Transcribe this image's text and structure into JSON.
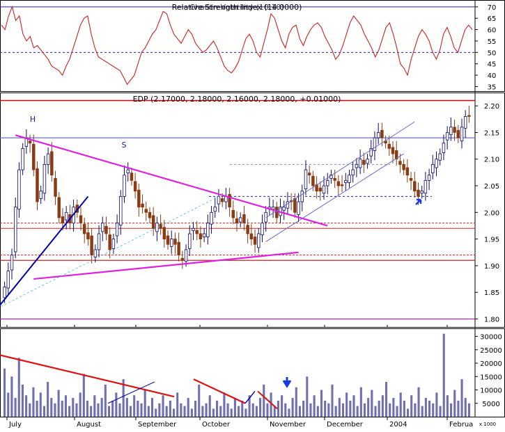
{
  "colors": {
    "frame": "#000000",
    "up_candle": "#0a0a6e",
    "down_candle": "#8b3a12",
    "indicator": "#cc2222",
    "indicator_ref_line": "#2222aa",
    "trend_magenta": "#dd22dd",
    "channel_blue": "#6666cc",
    "trend_navy": "#0000aa",
    "resistance_line": "#6666ff",
    "support_red": "#cc2222",
    "dashed_level": "#8888cc",
    "volume_bar": "#7070b0",
    "volume_trend_red": "#dd1111",
    "arrow_blue": "#1a3ae0",
    "top_red_line": "#dd0000",
    "bottom_line": "#cc00cc"
  },
  "chart_data": [
    {
      "type": "line",
      "panel": "indicator",
      "title": "Relative Strength Index (14.0000)",
      "overlaid_title": "Chaikin Volatility (10,10)",
      "y_ticks": [
        70,
        65,
        60,
        55,
        50,
        45,
        40,
        35
      ],
      "ylim": [
        33,
        73
      ],
      "reference_lines": [
        70,
        50
      ],
      "grid": false,
      "series": [
        {
          "values": [
            62,
            60,
            66,
            70,
            64,
            66,
            58,
            55,
            57,
            52,
            53,
            51,
            49,
            47,
            44,
            43,
            42,
            40,
            44,
            47,
            52,
            57,
            62,
            65,
            66,
            58,
            52,
            48,
            47,
            46,
            45,
            44,
            43,
            42,
            39,
            36,
            38,
            40,
            45,
            50,
            52,
            55,
            58,
            60,
            64,
            68,
            67,
            62,
            58,
            56,
            54,
            57,
            60,
            58,
            54,
            52,
            50,
            51,
            53,
            55,
            52,
            48,
            44,
            42,
            41,
            43,
            46,
            51,
            56,
            58,
            55,
            50,
            48,
            54,
            60,
            67,
            65,
            60,
            55,
            52,
            58,
            61,
            62,
            56,
            53,
            57,
            60,
            62,
            63,
            61,
            57,
            54,
            51,
            47,
            49,
            53,
            58,
            63,
            66,
            64,
            62,
            58,
            55,
            52,
            48,
            51,
            56,
            61,
            63,
            58,
            52,
            45,
            43,
            40,
            47,
            52,
            57,
            60,
            58,
            55,
            50,
            47,
            51,
            58,
            61,
            57,
            52,
            50,
            55,
            60,
            62,
            60
          ]
        }
      ]
    },
    {
      "type": "candlestick",
      "panel": "price",
      "title": "EDP (2.17000, 2.18000, 2.16000, 2.18000, +0.01000)",
      "y_ticks": [
        2.2,
        2.15,
        2.1,
        2.05,
        2.0,
        1.95,
        1.9,
        1.85,
        1.8
      ],
      "ylim": [
        1.785,
        2.225
      ],
      "grid": false,
      "annotations": [
        "H",
        "S"
      ],
      "horizontal_levels": [
        2.21,
        2.14,
        2.09,
        2.03,
        1.98,
        1.97,
        1.92,
        1.91,
        1.8
      ],
      "series": [
        {
          "name": "close",
          "values": [
            1.86,
            1.89,
            1.92,
            2.01,
            2.08,
            2.12,
            2.14,
            2.13,
            2.08,
            2.02,
            2.04,
            2.09,
            2.11,
            2.07,
            2.03,
            1.99,
            1.98,
            2.0,
            1.98,
            2.01,
            2.0,
            1.98,
            1.96,
            1.95,
            1.92,
            1.93,
            1.96,
            1.98,
            1.96,
            1.93,
            1.95,
            1.98,
            2.03,
            2.07,
            2.08,
            2.06,
            2.04,
            2.01,
            2.01,
            2.0,
            1.99,
            1.97,
            1.98,
            1.97,
            1.95,
            1.94,
            1.95,
            1.94,
            1.92,
            1.91,
            1.93,
            1.96,
            1.97,
            1.96,
            1.95,
            1.96,
            1.98,
            2.0,
            2.01,
            2.03,
            2.02,
            2.03,
            2.01,
            1.99,
            1.98,
            1.99,
            1.98,
            1.96,
            1.95,
            1.94,
            1.96,
            1.98,
            2.0,
            2.01,
            2.01,
            1.99,
            2.01,
            2.01,
            2.02,
            2.02,
            2.0,
            2.02,
            2.04,
            2.08,
            2.07,
            2.05,
            2.04,
            2.04,
            2.05,
            2.06,
            2.07,
            2.06,
            2.05,
            2.05,
            2.06,
            2.07,
            2.08,
            2.09,
            2.1,
            2.09,
            2.1,
            2.12,
            2.14,
            2.15,
            2.14,
            2.13,
            2.12,
            2.11,
            2.1,
            2.09,
            2.08,
            2.07,
            2.06,
            2.04,
            2.03,
            2.04,
            2.06,
            2.07,
            2.09,
            2.1,
            2.11,
            2.13,
            2.15,
            2.16,
            2.15,
            2.14,
            2.16,
            2.18,
            2.18
          ]
        }
      ]
    },
    {
      "type": "bar",
      "panel": "volume",
      "x_ticks": [
        "July",
        "August",
        "September",
        "October",
        "November",
        "December",
        "2004",
        "Februa"
      ],
      "y_ticks": [
        30000,
        25000,
        20000,
        15000,
        10000,
        5000
      ],
      "y_unit": "x 1000",
      "ylim": [
        0,
        33000
      ],
      "grid": false,
      "series": [
        {
          "values": [
            18000,
            9000,
            15000,
            7000,
            22000,
            12000,
            8000,
            5000,
            11000,
            6000,
            9000,
            4000,
            13000,
            7000,
            5000,
            10000,
            6000,
            8000,
            4000,
            7000,
            5000,
            9000,
            16000,
            6000,
            4000,
            8000,
            5000,
            7000,
            12000,
            4000,
            6000,
            9000,
            5000,
            14000,
            7000,
            4000,
            8000,
            6000,
            5000,
            10000,
            4000,
            7000,
            3000,
            5000,
            8000,
            4000,
            6000,
            3000,
            9000,
            5000,
            4000,
            7000,
            3000,
            6000,
            12000,
            4000,
            5000,
            8000,
            3000,
            6000,
            4000,
            9000,
            5000,
            3000,
            7000,
            4000,
            6000,
            3000,
            8000,
            5000,
            4000,
            7000,
            12000,
            5000,
            9000,
            4000,
            6000,
            8000,
            5000,
            3000,
            7000,
            11000,
            4000,
            6000,
            15000,
            5000,
            8000,
            4000,
            10000,
            6000,
            5000,
            12000,
            4000,
            7000,
            5000,
            9000,
            6000,
            8000,
            4000,
            11000,
            5000,
            7000,
            10000,
            4000,
            6000,
            8000,
            13000,
            5000,
            7000,
            4000,
            9000,
            6000,
            3000,
            8000,
            5000,
            11000,
            4000,
            7000,
            6000,
            5000,
            9000,
            4000,
            31000,
            8000,
            5000,
            10000,
            6000,
            14000,
            7000,
            5000
          ]
        }
      ],
      "annotations": [
        "volume trendlines",
        "down arrow (November)"
      ]
    }
  ]
}
